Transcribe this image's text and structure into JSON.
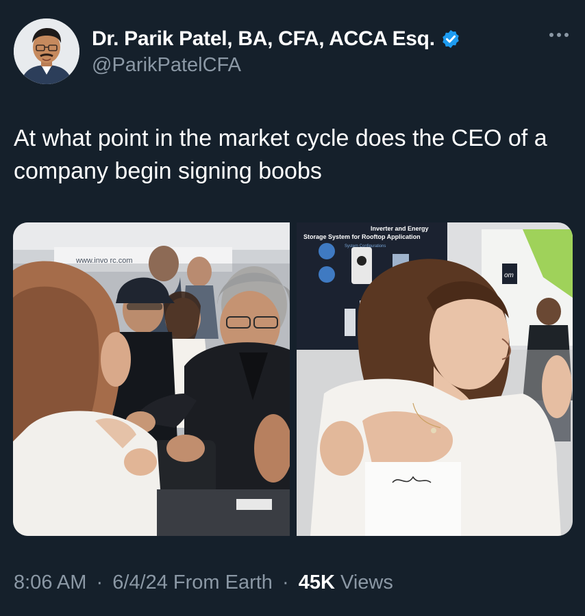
{
  "author": {
    "display_name": "Dr. Parik Patel, BA, CFA, ACCA Esq.",
    "handle": "@ParikPatelCFA",
    "verified": true
  },
  "tweet": {
    "text": "At what point in the market cycle does the CEO of a company begin signing boobs"
  },
  "media": {
    "left_photo": {
      "sign_text": "www.invo   rc.com"
    },
    "right_photo": {
      "poster_line1": "Inverter and Energy",
      "poster_line2": "Storage System for Rooftop Application",
      "poster_line3": "System Configurations",
      "signage_text": "om"
    }
  },
  "meta": {
    "time": "8:06 AM",
    "date": "6/4/24",
    "source": "From Earth",
    "views_count": "45K",
    "views_label": "Views",
    "separator": "·"
  },
  "icons": {
    "verified": "verified-badge-icon",
    "more": "more-options-icon"
  },
  "colors": {
    "background": "#15202b",
    "secondary_text": "#8b98a5",
    "verified_blue": "#1d9bf0"
  }
}
